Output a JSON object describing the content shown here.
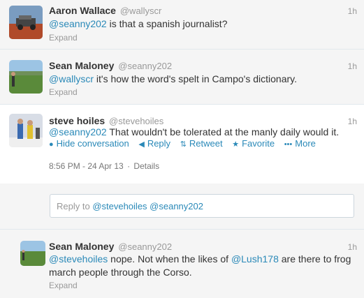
{
  "tweets": [
    {
      "fullname": "Aaron Wallace",
      "username": "@wallyscr",
      "time": "1h",
      "mention": "@seanny202",
      "text_rest": " is that a spanish journalist?",
      "expand": "Expand"
    },
    {
      "fullname": "Sean Maloney",
      "username": "@seanny202",
      "time": "1h",
      "mention": "@wallyscr",
      "text_rest": " it's how the word's spelt in Campo's dictionary.",
      "expand": "Expand"
    },
    {
      "fullname": "steve hoiles",
      "username": "@stevehoiles",
      "time": "1h",
      "mention": "@seanny202",
      "text_rest": " That wouldn't be tolerated at the manly daily would it.",
      "actions": {
        "hide": "Hide conversation",
        "reply": "Reply",
        "retweet": "Retweet",
        "favorite": "Favorite",
        "more": "More"
      },
      "timestamp": "8:56 PM - 24 Apr 13",
      "details": "Details"
    }
  ],
  "reply_box": {
    "prefix": "Reply to ",
    "mentions": "@stevehoiles @seanny202"
  },
  "reply_tweet": {
    "fullname": "Sean Maloney",
    "username": "@seanny202",
    "time": "1h",
    "mention1": "@stevehoiles",
    "text_mid": " nope. Not when the likes of ",
    "mention2": "@Lush178",
    "text_rest": " are there to frog march people through the Corso.",
    "expand": "Expand"
  },
  "colors": {
    "link": "#2a89b8",
    "muted": "#999999",
    "text": "#333333"
  }
}
